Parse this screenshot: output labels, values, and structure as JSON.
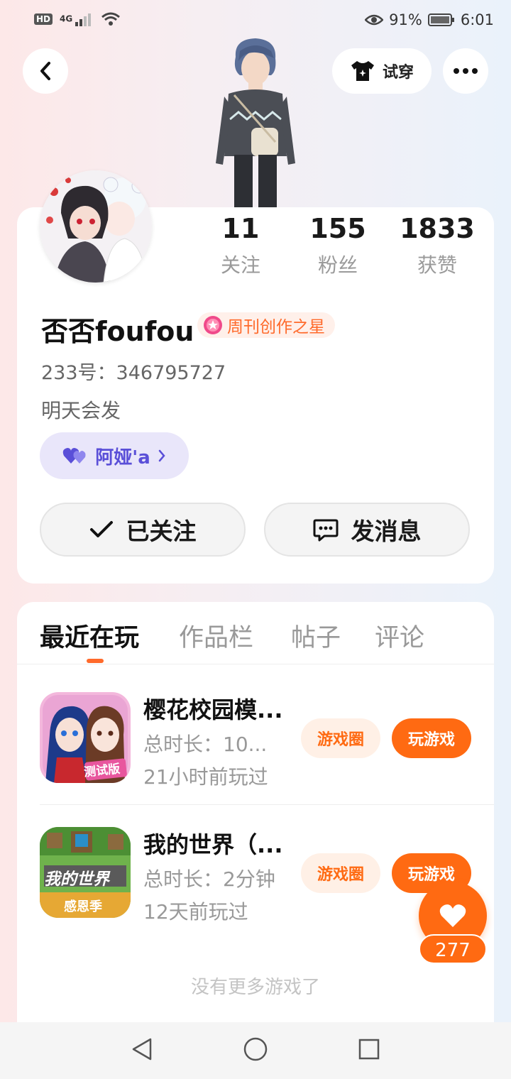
{
  "status": {
    "signal": "4G",
    "battery": "91%",
    "time": "6:01",
    "hd": "HD"
  },
  "header": {
    "try_on_label": "试穿"
  },
  "stats": [
    {
      "num": "11",
      "label": "关注"
    },
    {
      "num": "155",
      "label": "粉丝"
    },
    {
      "num": "1833",
      "label": "获赞"
    }
  ],
  "profile": {
    "name": "否否foufou",
    "badge": "周刊创作之星",
    "id_line": "233号：346795727",
    "signature": "明天会发",
    "partner": "阿娅'a"
  },
  "actions": {
    "followed": "已关注",
    "message": "发消息"
  },
  "tabs": [
    "最近在玩",
    "作品栏",
    "帖子",
    "评论"
  ],
  "games": [
    {
      "title": "樱花校园模...",
      "duration": "总时长：10...",
      "last_played": "21小时前玩过",
      "circle_label": "游戏圈",
      "play_label": "玩游戏",
      "icon_text": "测试版"
    },
    {
      "title": "我的世界（...",
      "duration": "总时长：2分钟",
      "last_played": "12天前玩过",
      "circle_label": "游戏圈",
      "play_label": "玩游戏",
      "icon_text_1": "我的世界",
      "icon_text_2": "感恩季"
    }
  ],
  "footer_text": "没有更多游戏了",
  "like": {
    "count": "277"
  },
  "colors": {
    "accent": "#ff6a12",
    "partner_bg": "#e9e6fa"
  }
}
